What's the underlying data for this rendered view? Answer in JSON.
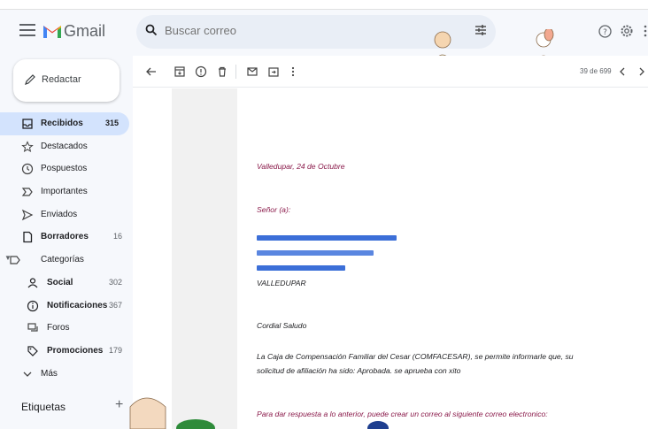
{
  "app": {
    "name": "Gmail"
  },
  "search": {
    "placeholder": "Buscar correo"
  },
  "compose": {
    "label": "Redactar"
  },
  "sidebar": {
    "items": [
      {
        "label": "Recibidos",
        "count": "315",
        "icon": "inbox-icon"
      },
      {
        "label": "Destacados",
        "count": "",
        "icon": "star-icon"
      },
      {
        "label": "Pospuestos",
        "count": "",
        "icon": "clock-icon"
      },
      {
        "label": "Importantes",
        "count": "",
        "icon": "important-icon"
      },
      {
        "label": "Enviados",
        "count": "",
        "icon": "send-icon"
      },
      {
        "label": "Borradores",
        "count": "16",
        "icon": "draft-icon"
      },
      {
        "label": "Categorías",
        "count": "",
        "icon": "label-icon"
      },
      {
        "label": "Social",
        "count": "302",
        "icon": "people-icon"
      },
      {
        "label": "Notificaciones",
        "count": "367",
        "icon": "info-icon"
      },
      {
        "label": "Foros",
        "count": "",
        "icon": "forum-icon"
      },
      {
        "label": "Promociones",
        "count": "179",
        "icon": "tag-icon"
      },
      {
        "label": "Más",
        "count": "",
        "icon": "chevron-down-icon"
      }
    ],
    "labels_heading": "Etiquetas"
  },
  "pager": {
    "count": "39 de 699"
  },
  "email": {
    "date_line": "Valledupar, 24 de Octubre",
    "salutation": "Señor (a):",
    "city": "VALLEDUPAR",
    "greeting": "Cordial Saludo",
    "body_line1": "La Caja de Compensación Familiar del Cesar (COMFACESAR), se permite informarle que, su",
    "body_line2": "solicitud de afiliación ha sido: Aprobada. se aprueba con xito",
    "reply_line": "Para dar respuesta a lo anterior, puede crear un correo al siguiente correo electronico:"
  },
  "colors": {
    "accent": "#d3e3fd",
    "email_purple": "#8a1a4a",
    "redaction": "#3c6fd8"
  }
}
